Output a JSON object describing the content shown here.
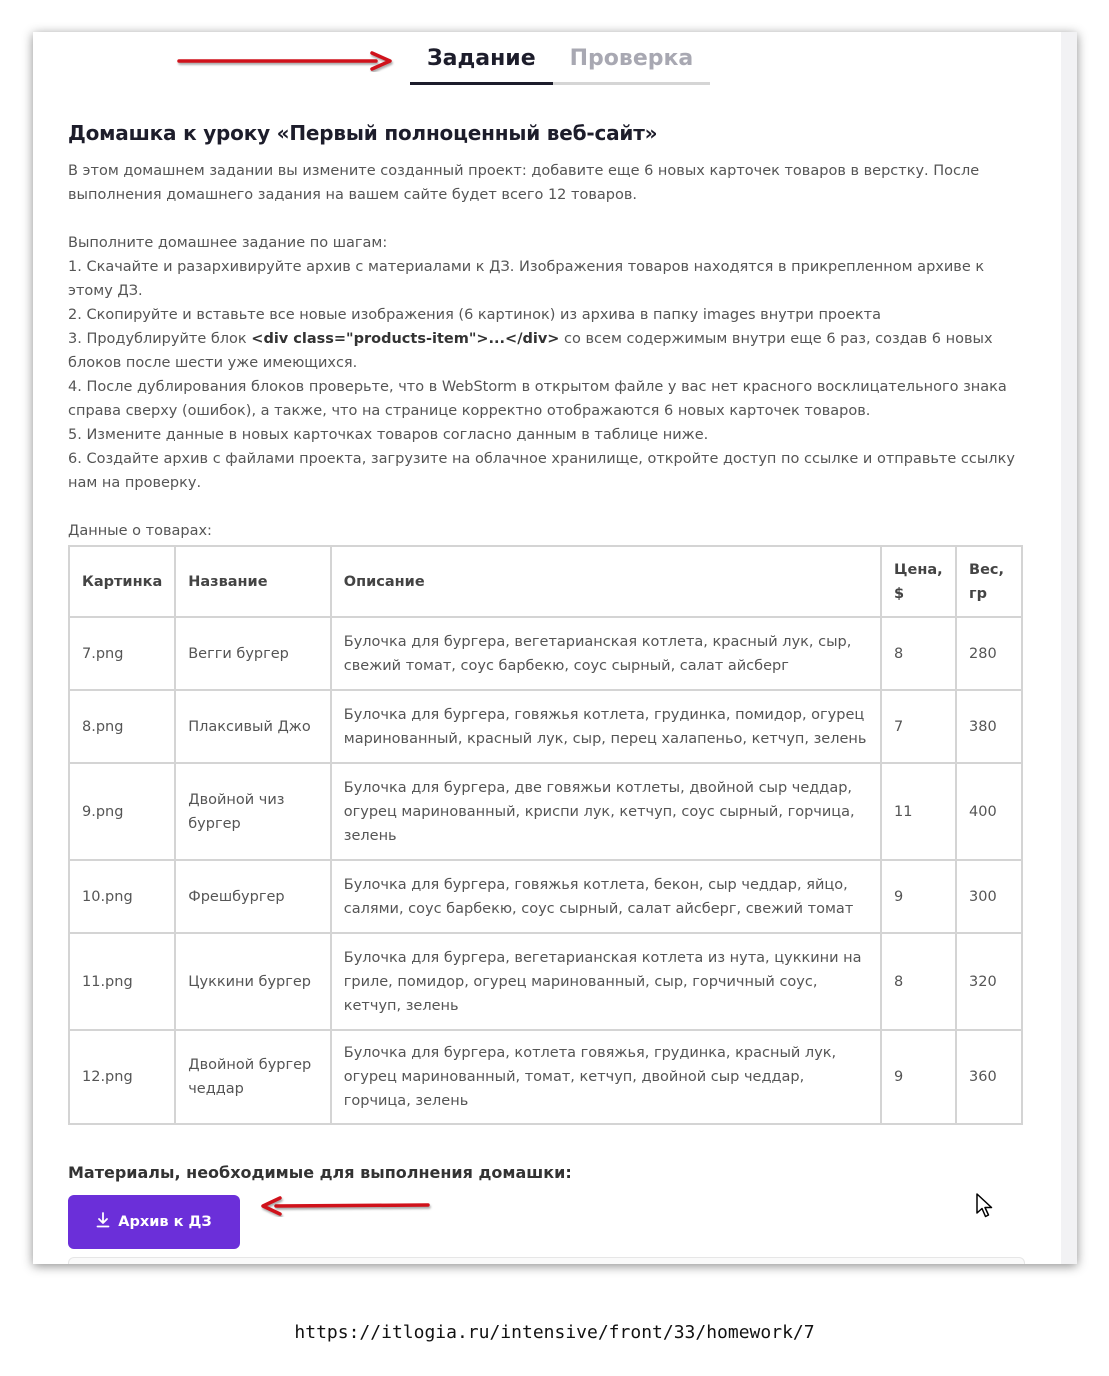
{
  "tabs": [
    {
      "label": "Задание",
      "active": true
    },
    {
      "label": "Проверка",
      "active": false
    }
  ],
  "title": "Домашка к уроку «Первый полноценный веб-сайт»",
  "intro": {
    "p1": "В этом домашнем задании вы измените созданный проект: добавите еще 6 новых карточек товаров в верстку. После выполнения домашнего задания на вашем сайте будет всего 12 товаров.",
    "steps_heading": "Выполните домашнее задание по шагам:",
    "step1": "1. Скачайте и разархивируйте архив с материалами к ДЗ. Изображения товаров находятся в прикрепленном архиве к этому ДЗ.",
    "step2": "2. Скопируйте и вставьте все новые изображения (6 картинок) из архива в папку images внутри проекта",
    "step3_pre": "3. Продублируйте блок ",
    "step3_code": "<div class=\"products-item\">...</div>",
    "step3_post": " со всем содержимым внутри еще 6 раз, создав 6 новых блоков после шести уже имеющихся.",
    "step4": "4. После дублирования блоков проверьте, что в WebStorm в открытом файле у вас нет красного восклицательного знака справа сверху (ошибок), а также, что на странице корректно отображаются 6 новых карточек товаров.",
    "step5": "5. Измените данные в новых карточках товаров согласно данным в таблице ниже.",
    "step6": "6. Создайте архив с файлами проекта, загрузите на облачное хранилище, откройте доступ по ссылке и отправьте ссылку нам на проверку.",
    "table_caption": "Данные о товарах:"
  },
  "table": {
    "headers": [
      "Картинка",
      "Название",
      "Описание",
      "Цена, $",
      "Вес, гр"
    ],
    "rows": [
      [
        "7.png",
        "Вегги бургер",
        "Булочка для бургера, вегетарианская котлета, красный лук, сыр, свежий томат, соус барбекю, соус сырный, салат айсберг",
        "8",
        "280"
      ],
      [
        "8.png",
        "Плаксивый Джо",
        "Булочка для бургера, говяжья котлета, грудинка, помидор, огурец маринованный, красный лук, сыр, перец халапеньо, кетчуп, зелень",
        "7",
        "380"
      ],
      [
        "9.png",
        "Двойной чиз бургер",
        "Булочка для бургера, две говяжьи котлеты, двойной сыр чеддар, огурец маринованный, криспи лук, кетчуп, соус сырный, горчица, зелень",
        "11",
        "400"
      ],
      [
        "10.png",
        "Фрешбургер",
        "Булочка для бургера, говяжья котлета, бекон, сыр чеддар, яйцо, салями, соус барбекю, соус сырный, салат айсберг, свежий томат",
        "9",
        "300"
      ],
      [
        "11.png",
        "Цуккини бургер",
        "Булочка для бургера, вегетарианская котлета из нута, цуккини на гриле, помидор, огурец маринованный, сыр, горчичный соус, кетчуп, зелень",
        "8",
        "320"
      ],
      [
        "12.png",
        "Двойной бургер чеддар",
        "Булочка для бургера, котлета говяжья, грудинка, красный лук, огурец маринованный, томат, кетчуп, двойной сыр чеддар, горчица, зелень",
        "9",
        "360"
      ]
    ]
  },
  "materials": {
    "title": "Материалы, необходимые для выполнения домашки:",
    "button_label": "Архив к ДЗ",
    "button_icon": "download-icon"
  },
  "annotation": {
    "arrow_color": "#d0121b"
  },
  "url": "https://itlogia.ru/intensive/front/33/homework/7",
  "colors": {
    "accent": "#6b2fd9",
    "title": "#1d1d2b",
    "tab_inactive": "#a8a8b2",
    "border": "#d4d4d4"
  }
}
